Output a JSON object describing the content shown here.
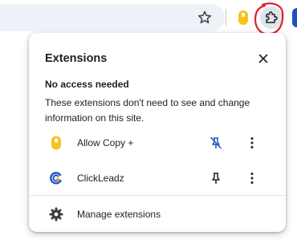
{
  "toolbar": {
    "star_icon": "star-icon",
    "extensions_icon": "puzzle-piece-icon"
  },
  "popup": {
    "title": "Extensions",
    "section_heading": "No access needed",
    "section_description": "These extensions don't need to see and change information on this site.",
    "extensions": [
      {
        "name": "Allow Copy +",
        "icon": "allow-copy-icon",
        "pinned": false,
        "pin_icon": "unpinned-icon",
        "more_icon": "more-vertical-icon"
      },
      {
        "name": "ClickLeadz",
        "icon": "clickleadz-icon",
        "pinned": true,
        "pin_icon": "pin-icon",
        "more_icon": "more-vertical-icon"
      }
    ],
    "manage_label": "Manage extensions",
    "manage_icon": "gear-icon"
  },
  "colors": {
    "accent_blue": "#1f4fbf",
    "annotation_red": "#e0202a",
    "allow_copy_yellow": "#f6c21c"
  }
}
